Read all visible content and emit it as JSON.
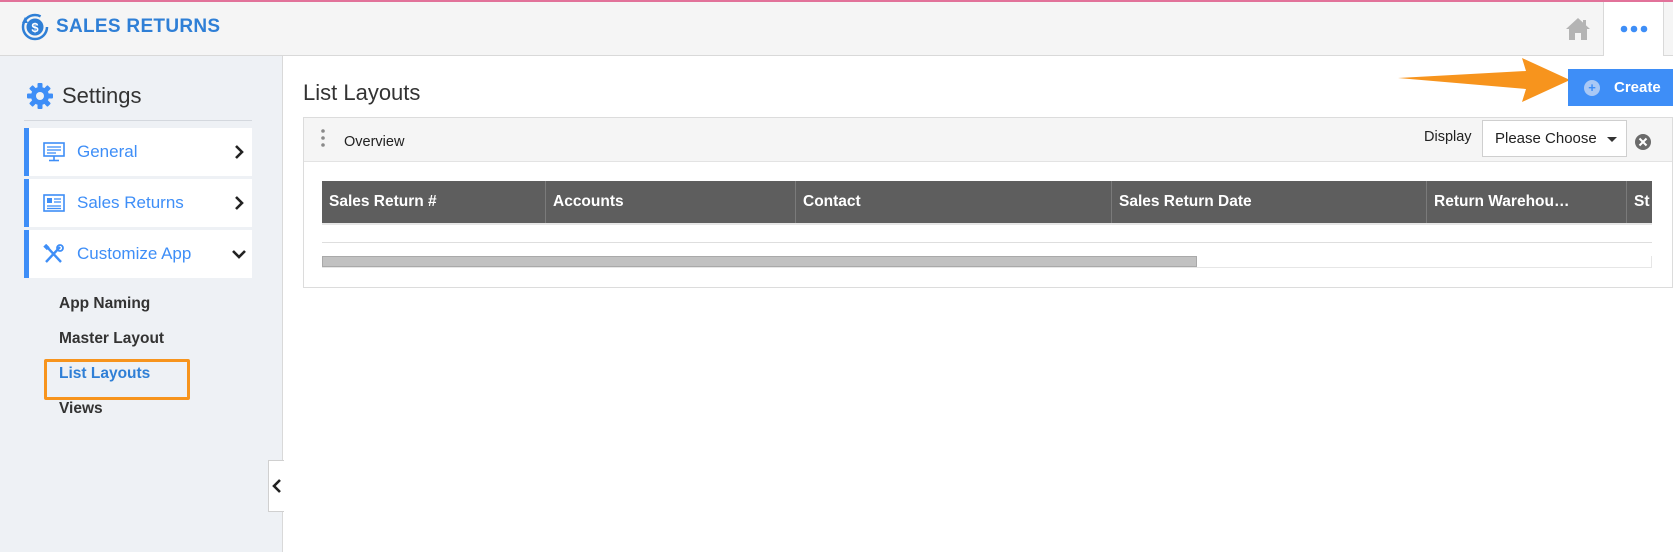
{
  "header": {
    "app_title": "SALES RETURNS",
    "logo_icon": "dollar-refresh-icon",
    "home_icon": "home-icon",
    "more_icon": "more-dots-icon",
    "accent_color": "#2f7fd6",
    "top_border_color": "#e2729a"
  },
  "sidebar": {
    "title": "Settings",
    "title_icon": "gear-icon",
    "items": [
      {
        "label": "General",
        "icon": "monitor-icon",
        "chevron": "chevron-right-icon"
      },
      {
        "label": "Sales Returns",
        "icon": "form-icon",
        "chevron": "chevron-right-icon"
      },
      {
        "label": "Customize App",
        "icon": "tools-icon",
        "chevron": "chevron-down-icon"
      }
    ],
    "sub_items": [
      {
        "label": "App Naming"
      },
      {
        "label": "Master Layout"
      },
      {
        "label": "List Layouts",
        "active": true
      },
      {
        "label": "Views"
      }
    ],
    "nav_color": "#3e8ef7",
    "highlight_color": "#f7941d"
  },
  "main": {
    "page_title": "List Layouts",
    "create_button": {
      "label": "Create",
      "icon": "plus-circle-icon",
      "color": "#3e8ef7"
    },
    "arrow_color": "#f7941d",
    "panel": {
      "title": "Overview",
      "display_label": "Display",
      "display_value": "Please Choose",
      "close_icon": "close-circle-icon",
      "drag_icon": "drag-handle-icon"
    },
    "table": {
      "header_color": "#5e5e5e",
      "columns": [
        {
          "label": "Sales Return #"
        },
        {
          "label": "Accounts"
        },
        {
          "label": "Contact"
        },
        {
          "label": "Sales Return Date"
        },
        {
          "label": "Return Warehou…"
        },
        {
          "label": "St"
        }
      ]
    }
  }
}
